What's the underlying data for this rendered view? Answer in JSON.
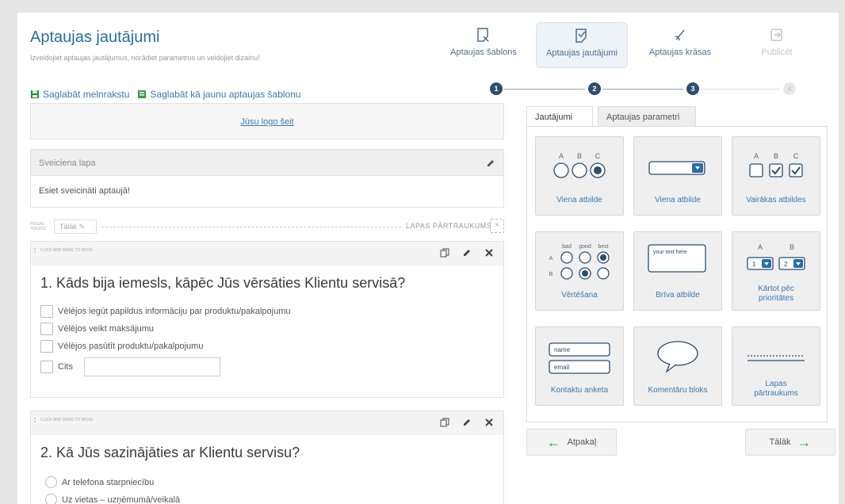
{
  "header": {
    "title": "Aptaujas jautājumi",
    "subtitle": "Izveidojiet aptaujas jautājumus, norādiet parametrus un veidojiet dizainu!",
    "save_draft": "Saglabāt melnrakstu",
    "save_template": "Saglabāt kā jaunu aptaujas šablonu"
  },
  "wizard": {
    "steps": [
      {
        "label": "Aptaujas šablons",
        "num": "1"
      },
      {
        "label": "Aptaujas jautājumi",
        "num": "2"
      },
      {
        "label": "Aptaujas krāsas",
        "num": "3"
      },
      {
        "label": "Publicēt",
        "num": "4"
      }
    ]
  },
  "logo": {
    "link": "Jūsu logo šeit"
  },
  "welcome": {
    "heading": "Sveiciena lapa",
    "text": "Esiet sveicināti aptaujā!"
  },
  "pagebreak": {
    "small": "POGAS TEKSTS",
    "button": "Tālāk",
    "label": "LAPAS PĀRTRAUKUMS",
    "close": "×"
  },
  "drag_hint": "CLICK AND DRAG TO MOVE",
  "questions": [
    {
      "title": "1. Kāds bija iemesls, kāpēc Jūs vērsāties Klientu servisā?",
      "options": [
        "Vēlējos iegūt papildus informāciju par produktu/pakalpojumu",
        "Vēlējos veikt maksājumu",
        "Vēlējos pasūtīt produktu/pakalpojumu",
        "Cits"
      ]
    },
    {
      "title": "2. Kā Jūs sazinājāties ar Klientu servisu?",
      "options": [
        "Ar telefona starpniecību",
        "Uz vietas – uzņēmumā/veikalā"
      ]
    }
  ],
  "tabs": [
    "Jautājumi",
    "Aptaujas parametri"
  ],
  "tiles": {
    "single_radio": "Viena atbilde",
    "single_dropdown": "Viena atbilde",
    "multiple": "Vairākas atbildes",
    "rating": "Vērtēšana",
    "free_text": "Brīva atbilde",
    "priority_l1": "Kārtot pēc",
    "priority_l2": "prioritātes",
    "contact": "Kontaktu anketa",
    "comment": "Komentāru bloks",
    "pagebreak_l1": "Lapas",
    "pagebreak_l2": "pārtraukums"
  },
  "tile_art": {
    "abc_a": "A",
    "abc_b": "B",
    "abc_c": "C",
    "rating_bad": "bad",
    "rating_good": "good",
    "rating_best": "best",
    "rating_row_a": "A",
    "rating_row_b": "B",
    "free_text_placeholder": "your text here",
    "prio_a": "A",
    "prio_b": "B",
    "prio_1": "1",
    "prio_2": "2",
    "contact_name": "name",
    "contact_email": "email"
  },
  "nav": {
    "back": "Atpakaļ",
    "next": "Tālāk"
  },
  "colors": {
    "accent": "#3b78b0",
    "dark_step": "#2d4e6e",
    "green_arrow": "#2aa83a"
  }
}
